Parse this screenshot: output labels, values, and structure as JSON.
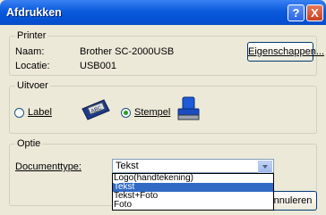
{
  "window": {
    "title": "Afdrukken",
    "help_glyph": "?",
    "close_glyph": "X"
  },
  "printer": {
    "legend": "Printer",
    "name_label": "Naam:",
    "name_value": "Brother SC-2000USB",
    "location_label": "Locatie:",
    "location_value": "USB001",
    "properties_button": "Eigenschappen..."
  },
  "output": {
    "legend": "Uitvoer",
    "label_option": "Label",
    "stamp_option": "Stempel",
    "selected": "Stempel"
  },
  "option": {
    "legend": "Optie",
    "doctype_label": "Documenttype:",
    "doctype_value": "Tekst",
    "doctype_options": [
      "Logo(handtekening)",
      "Tekst",
      "Tekst+Foto",
      "Foto"
    ],
    "selected_index": 1
  },
  "cancel_button": "nnuleren"
}
